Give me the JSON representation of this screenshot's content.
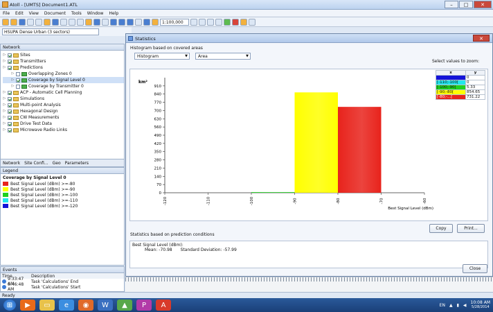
{
  "window": {
    "title": "Atoll - [UMTS] Document1.ATL"
  },
  "menu": [
    "File",
    "Edit",
    "View",
    "Document",
    "Tools",
    "Window",
    "Help"
  ],
  "toolbar": {
    "zoom": "1:100,000",
    "combo": "HSUPA Dense Urban (3 sectors)"
  },
  "network_panel": {
    "title": "Network",
    "tree": [
      {
        "label": "Sites",
        "indent": 0,
        "checked": true
      },
      {
        "label": "Transmitters",
        "indent": 0,
        "checked": true
      },
      {
        "label": "Predictions",
        "indent": 0,
        "checked": true
      },
      {
        "label": "Overlapping Zones 0",
        "indent": 1,
        "checked": false
      },
      {
        "label": "Coverage by Signal Level 0",
        "indent": 1,
        "checked": true,
        "selected": true
      },
      {
        "label": "Coverage by Transmitter 0",
        "indent": 1,
        "checked": false
      },
      {
        "label": "ACP - Automatic Cell Planning",
        "indent": 0,
        "checked": true
      },
      {
        "label": "Simulations",
        "indent": 0,
        "checked": true
      },
      {
        "label": "Multi-point Analysis",
        "indent": 0,
        "checked": true
      },
      {
        "label": "Hexagonal Design",
        "indent": 0,
        "checked": true
      },
      {
        "label": "CW Measurements",
        "indent": 0,
        "checked": true
      },
      {
        "label": "Drive Test Data",
        "indent": 0,
        "checked": true
      },
      {
        "label": "Microwave Radio Links",
        "indent": 0,
        "checked": true
      }
    ],
    "tabs": [
      "Network",
      "Site Confi...",
      "Geo",
      "Parameters"
    ]
  },
  "legend_panel": {
    "title": "Legend",
    "heading": "Coverage by Signal Level 0",
    "items": [
      {
        "label": "Best Signal Level (dBm) >=-80",
        "color": "#e8231c"
      },
      {
        "label": "Best Signal Level (dBm) >=-90",
        "color": "#ffff00"
      },
      {
        "label": "Best Signal Level (dBm) >=-100",
        "color": "#1fd11f"
      },
      {
        "label": "Best Signal Level (dBm) >=-110",
        "color": "#22e6ee"
      },
      {
        "label": "Best Signal Level (dBm) >=-120",
        "color": "#1414d8"
      }
    ]
  },
  "events_panel": {
    "title": "Events",
    "columns": [
      "Time",
      "Description"
    ],
    "rows": [
      {
        "time": "9:33:47 AM",
        "desc": "Task 'Calculations' End"
      },
      {
        "time": "9:46:48 AM",
        "desc": "Task 'Calculations' Start"
      },
      {
        "time": "10:01:41 AM",
        "desc": "Task 'Calculations' End"
      }
    ]
  },
  "status": "Ready",
  "dialog": {
    "title": "Statistics",
    "histogram_heading": "Histogram based on covered areas",
    "mode_select": "Histogram",
    "unit_select": "Area",
    "zoom_label": "Select values to zoom:",
    "copy_button": "Copy",
    "print_button": "Print...",
    "stats_heading": "Statistics based on prediction conditions",
    "stats_line1": "Best Signal Level (dBm):",
    "stats_mean": "Mean: -70.98",
    "stats_std": "Standard Deviation: -57.99",
    "close_button": "Close",
    "value_table": {
      "headers": [
        "x",
        "y"
      ],
      "rows": [
        {
          "x": "",
          "y": "0",
          "color": "#1414d8"
        },
        {
          "x": "[-110;-100[",
          "y": "0",
          "color": "#22e6ee"
        },
        {
          "x": "[-100;-90[",
          "y": "5.33",
          "color": "#1fd11f"
        },
        {
          "x": "[-90;-80[",
          "y": "854.65",
          "color": "#ffff00"
        },
        {
          "x": "[-80;-...[",
          "y": "731.22",
          "color": "#e8231c"
        }
      ]
    }
  },
  "chart_data": {
    "type": "bar",
    "ylabel": "km²",
    "xlabel": "Best Signal Level (dBm)",
    "x_ticks": [
      "-120",
      "-110",
      "-100",
      "-90",
      "-80",
      "-70",
      "-60"
    ],
    "y_ticks": [
      0,
      70,
      140,
      210,
      280,
      350,
      420,
      490,
      560,
      630,
      700,
      770,
      840,
      910
    ],
    "ylim": [
      0,
      980
    ],
    "xlim": [
      -120,
      -60
    ],
    "bars": [
      {
        "from": -110,
        "to": -100,
        "value": 0,
        "color": "#22e6ee"
      },
      {
        "from": -100,
        "to": -90,
        "value": 5.33,
        "color": "#1fd11f"
      },
      {
        "from": -90,
        "to": -80,
        "value": 854.65,
        "color": "#ffff00"
      },
      {
        "from": -80,
        "to": -70,
        "value": 731.22,
        "color": "#e8231c"
      }
    ]
  },
  "taskbar": {
    "lang": "EN",
    "time": "10:08 AM",
    "date": "5/28/2014"
  }
}
